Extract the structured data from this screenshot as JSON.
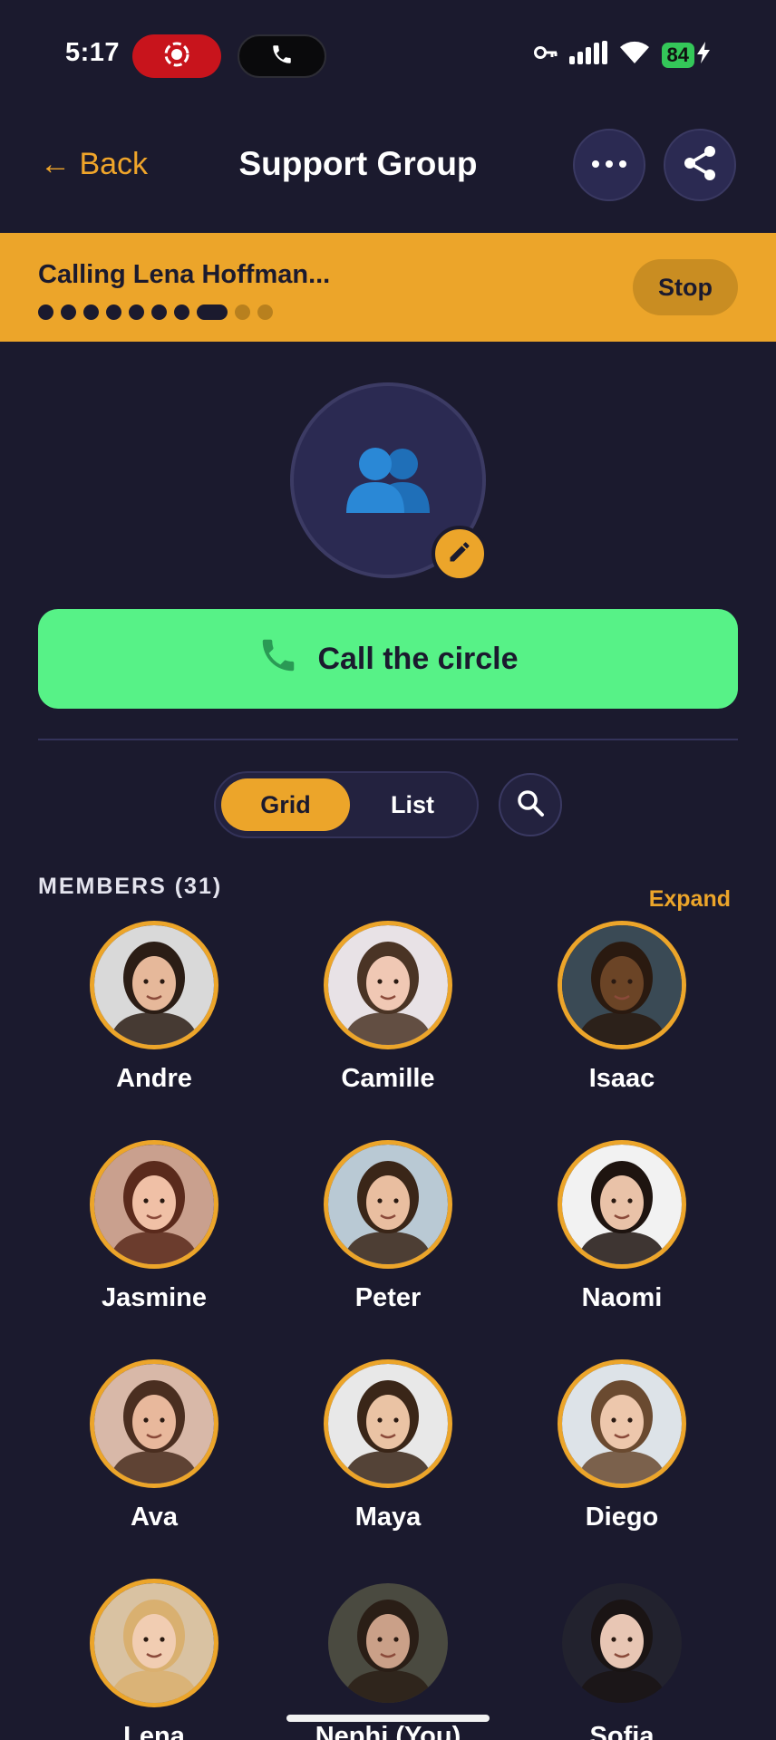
{
  "status_bar": {
    "time": "5:17",
    "battery": "84",
    "icons": [
      "screen-record-icon",
      "phone-icon",
      "vpn-key-icon",
      "signal-icon",
      "wifi-icon",
      "battery-charging-icon"
    ]
  },
  "header": {
    "back_label": "← Back",
    "title": "Support Group",
    "more_icon": "more-horizontal-icon",
    "share_icon": "share-icon"
  },
  "calling_banner": {
    "text": "Calling Lena Hoffman...",
    "stop_label": "Stop",
    "progress_total_steps": 10,
    "progress_current_step": 8
  },
  "group": {
    "avatar_icon": "people-icon",
    "edit_icon": "pencil-icon"
  },
  "call_button": {
    "label": "Call the circle",
    "icon": "phone-icon"
  },
  "view_toggle": {
    "options": [
      "Grid",
      "List"
    ],
    "selected": "Grid"
  },
  "members": {
    "header": "MEMBERS (31)",
    "expand_label": "Expand",
    "list": [
      {
        "name": "Andre",
        "bg": "#d9d9d9",
        "skin": "#e6b89a",
        "hair": "#2b1d15"
      },
      {
        "name": "Camille",
        "bg": "#e8e2e6",
        "skin": "#f0c8b4",
        "hair": "#4a3425"
      },
      {
        "name": "Isaac",
        "bg": "#3a4a55",
        "skin": "#6b4426",
        "hair": "#2a1a10"
      },
      {
        "name": "Jasmine",
        "bg": "#c9a08e",
        "skin": "#f0c0a6",
        "hair": "#5a2a1c"
      },
      {
        "name": "Peter",
        "bg": "#b9c9d4",
        "skin": "#e9bea0",
        "hair": "#3a2618"
      },
      {
        "name": "Naomi",
        "bg": "#f2f2f2",
        "skin": "#e9c2a8",
        "hair": "#1e1410"
      },
      {
        "name": "Ava",
        "bg": "#d8b8a8",
        "skin": "#e8b89c",
        "hair": "#4a2e20"
      },
      {
        "name": "Maya",
        "bg": "#e8e8e8",
        "skin": "#eac3a4",
        "hair": "#3a2618"
      },
      {
        "name": "Diego",
        "bg": "#dde3e8",
        "skin": "#edc7ac",
        "hair": "#6a4a30"
      },
      {
        "name": "Lena",
        "bg": "#d9c2a2",
        "skin": "#f1cdb2",
        "hair": "#d9b070"
      },
      {
        "name": "Nephi (You)",
        "bg": "#4a4a40",
        "skin": "#caa088",
        "hair": "#2a1e16"
      },
      {
        "name": "Sofia",
        "bg": "#22222e",
        "skin": "#e8c6b4",
        "hair": "#1a1414"
      }
    ]
  },
  "colors": {
    "background": "#1b1a2e",
    "accent": "#eca52a",
    "call_green": "#57f287",
    "surface": "#2b2a52"
  }
}
